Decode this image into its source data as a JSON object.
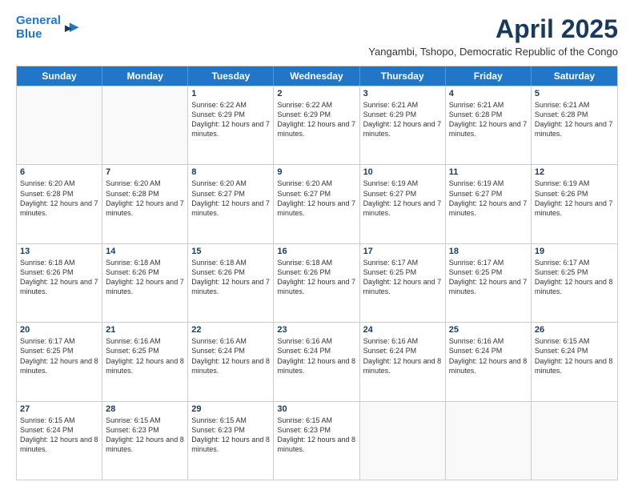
{
  "logo": {
    "line1": "General",
    "line2": "Blue"
  },
  "title": "April 2025",
  "subtitle": "Yangambi, Tshopo, Democratic Republic of the Congo",
  "header_days": [
    "Sunday",
    "Monday",
    "Tuesday",
    "Wednesday",
    "Thursday",
    "Friday",
    "Saturday"
  ],
  "rows": [
    [
      {
        "day": "",
        "text": ""
      },
      {
        "day": "",
        "text": ""
      },
      {
        "day": "1",
        "text": "Sunrise: 6:22 AM\nSunset: 6:29 PM\nDaylight: 12 hours and 7 minutes."
      },
      {
        "day": "2",
        "text": "Sunrise: 6:22 AM\nSunset: 6:29 PM\nDaylight: 12 hours and 7 minutes."
      },
      {
        "day": "3",
        "text": "Sunrise: 6:21 AM\nSunset: 6:29 PM\nDaylight: 12 hours and 7 minutes."
      },
      {
        "day": "4",
        "text": "Sunrise: 6:21 AM\nSunset: 6:28 PM\nDaylight: 12 hours and 7 minutes."
      },
      {
        "day": "5",
        "text": "Sunrise: 6:21 AM\nSunset: 6:28 PM\nDaylight: 12 hours and 7 minutes."
      }
    ],
    [
      {
        "day": "6",
        "text": "Sunrise: 6:20 AM\nSunset: 6:28 PM\nDaylight: 12 hours and 7 minutes."
      },
      {
        "day": "7",
        "text": "Sunrise: 6:20 AM\nSunset: 6:28 PM\nDaylight: 12 hours and 7 minutes."
      },
      {
        "day": "8",
        "text": "Sunrise: 6:20 AM\nSunset: 6:27 PM\nDaylight: 12 hours and 7 minutes."
      },
      {
        "day": "9",
        "text": "Sunrise: 6:20 AM\nSunset: 6:27 PM\nDaylight: 12 hours and 7 minutes."
      },
      {
        "day": "10",
        "text": "Sunrise: 6:19 AM\nSunset: 6:27 PM\nDaylight: 12 hours and 7 minutes."
      },
      {
        "day": "11",
        "text": "Sunrise: 6:19 AM\nSunset: 6:27 PM\nDaylight: 12 hours and 7 minutes."
      },
      {
        "day": "12",
        "text": "Sunrise: 6:19 AM\nSunset: 6:26 PM\nDaylight: 12 hours and 7 minutes."
      }
    ],
    [
      {
        "day": "13",
        "text": "Sunrise: 6:18 AM\nSunset: 6:26 PM\nDaylight: 12 hours and 7 minutes."
      },
      {
        "day": "14",
        "text": "Sunrise: 6:18 AM\nSunset: 6:26 PM\nDaylight: 12 hours and 7 minutes."
      },
      {
        "day": "15",
        "text": "Sunrise: 6:18 AM\nSunset: 6:26 PM\nDaylight: 12 hours and 7 minutes."
      },
      {
        "day": "16",
        "text": "Sunrise: 6:18 AM\nSunset: 6:26 PM\nDaylight: 12 hours and 7 minutes."
      },
      {
        "day": "17",
        "text": "Sunrise: 6:17 AM\nSunset: 6:25 PM\nDaylight: 12 hours and 7 minutes."
      },
      {
        "day": "18",
        "text": "Sunrise: 6:17 AM\nSunset: 6:25 PM\nDaylight: 12 hours and 7 minutes."
      },
      {
        "day": "19",
        "text": "Sunrise: 6:17 AM\nSunset: 6:25 PM\nDaylight: 12 hours and 8 minutes."
      }
    ],
    [
      {
        "day": "20",
        "text": "Sunrise: 6:17 AM\nSunset: 6:25 PM\nDaylight: 12 hours and 8 minutes."
      },
      {
        "day": "21",
        "text": "Sunrise: 6:16 AM\nSunset: 6:25 PM\nDaylight: 12 hours and 8 minutes."
      },
      {
        "day": "22",
        "text": "Sunrise: 6:16 AM\nSunset: 6:24 PM\nDaylight: 12 hours and 8 minutes."
      },
      {
        "day": "23",
        "text": "Sunrise: 6:16 AM\nSunset: 6:24 PM\nDaylight: 12 hours and 8 minutes."
      },
      {
        "day": "24",
        "text": "Sunrise: 6:16 AM\nSunset: 6:24 PM\nDaylight: 12 hours and 8 minutes."
      },
      {
        "day": "25",
        "text": "Sunrise: 6:16 AM\nSunset: 6:24 PM\nDaylight: 12 hours and 8 minutes."
      },
      {
        "day": "26",
        "text": "Sunrise: 6:15 AM\nSunset: 6:24 PM\nDaylight: 12 hours and 8 minutes."
      }
    ],
    [
      {
        "day": "27",
        "text": "Sunrise: 6:15 AM\nSunset: 6:24 PM\nDaylight: 12 hours and 8 minutes."
      },
      {
        "day": "28",
        "text": "Sunrise: 6:15 AM\nSunset: 6:23 PM\nDaylight: 12 hours and 8 minutes."
      },
      {
        "day": "29",
        "text": "Sunrise: 6:15 AM\nSunset: 6:23 PM\nDaylight: 12 hours and 8 minutes."
      },
      {
        "day": "30",
        "text": "Sunrise: 6:15 AM\nSunset: 6:23 PM\nDaylight: 12 hours and 8 minutes."
      },
      {
        "day": "",
        "text": ""
      },
      {
        "day": "",
        "text": ""
      },
      {
        "day": "",
        "text": ""
      }
    ]
  ]
}
